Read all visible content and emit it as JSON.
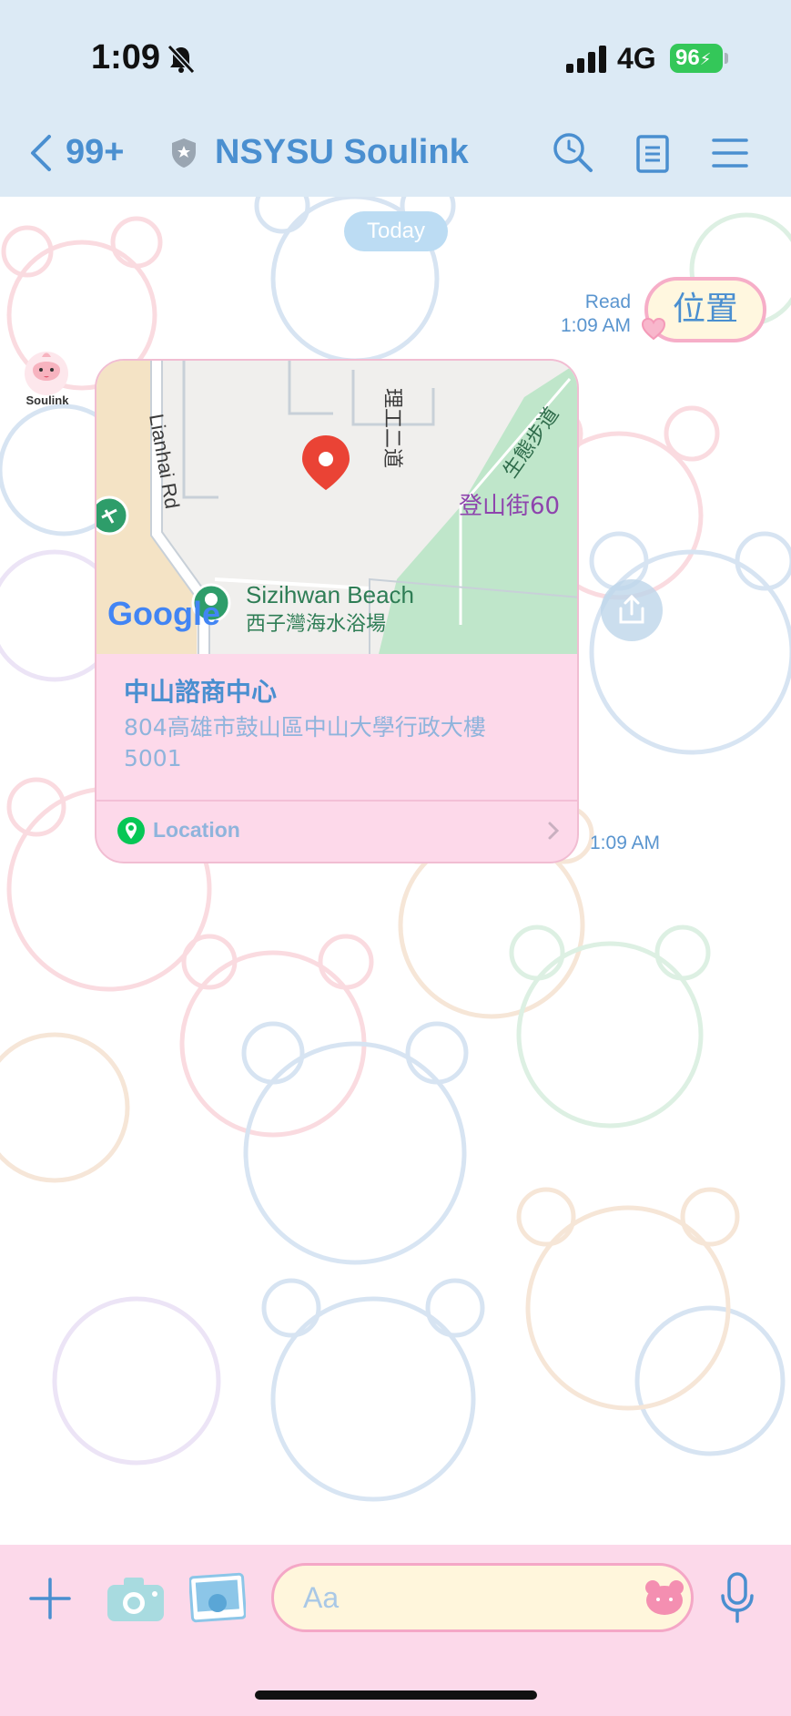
{
  "status_bar": {
    "time": "1:09",
    "network": "4G",
    "battery": "96"
  },
  "header": {
    "back_count": "99+",
    "title": "NSYSU Soulink"
  },
  "chat": {
    "date_separator": "Today",
    "outgoing": {
      "read_label": "Read",
      "time": "1:09 AM",
      "text": "位置"
    },
    "sender": {
      "name": "Soulink"
    },
    "location_card": {
      "map_labels": {
        "road_1": "Lianhai Rd",
        "road_2": "理工二道",
        "road_3": "生態步道",
        "street": "登山街60",
        "beach_en": "Sizihwan Beach",
        "beach_zh": "西子灣海水浴場",
        "provider": "Google"
      },
      "place_name": "中山諮商中心",
      "address": "804高雄市鼓山區中山大學行政大樓5001",
      "action_label": "Location",
      "time": "1:09 AM"
    }
  },
  "input_bar": {
    "placeholder": "Aa"
  },
  "colors": {
    "header_bg": "#dceaf5",
    "accent_blue": "#4a8fd0",
    "pink_bar": "#fcd9ea",
    "card_pink": "#fdd9ea",
    "battery_green": "#34c759"
  }
}
